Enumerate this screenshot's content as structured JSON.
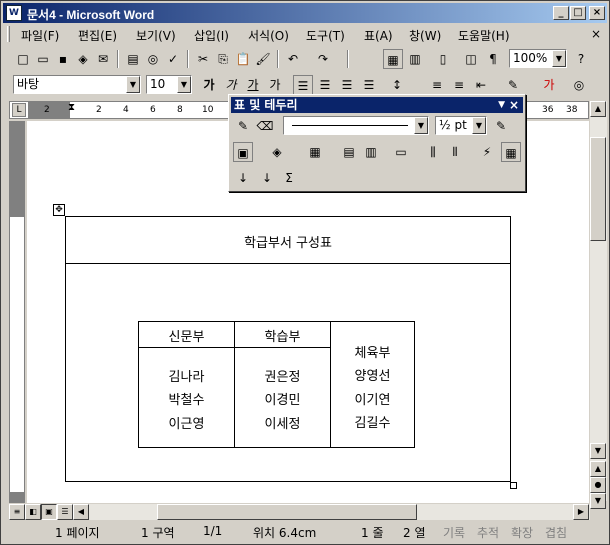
{
  "window": {
    "title": "문서4 - Microsoft Word",
    "icon": "W"
  },
  "menu": [
    "파일(F)",
    "편집(E)",
    "보기(V)",
    "삽입(I)",
    "서식(O)",
    "도구(T)",
    "표(A)",
    "창(W)",
    "도움말(H)"
  ],
  "menu_close": "×",
  "toolbar": {
    "zoom": "100%",
    "font_name": "바탕",
    "font_size": "10"
  },
  "ruler_ticks": [
    "2",
    "2",
    "4",
    "6",
    "8",
    "10",
    "36",
    "38"
  ],
  "table_panel": {
    "title": "표 및 테두리",
    "line_weight": "½ pt"
  },
  "document": {
    "table_title": "학급부서 구성표",
    "columns": [
      {
        "header": "신문부",
        "members": [
          "김나라",
          "박철수",
          "이근영"
        ]
      },
      {
        "header": "학습부",
        "members": [
          "권은정",
          "이경민",
          "이세정"
        ]
      },
      {
        "header": "",
        "members": [
          "체육부",
          "양영선",
          "이기연",
          "김길수"
        ]
      }
    ]
  },
  "status": {
    "page": "1 페이지",
    "section": "1 구역",
    "page_of": "1/1",
    "position": "위치 6.4cm",
    "line": "1 줄",
    "column": "2 열",
    "rec": "기록",
    "trk": "추적",
    "ext": "확장",
    "ovr": "겹침"
  }
}
